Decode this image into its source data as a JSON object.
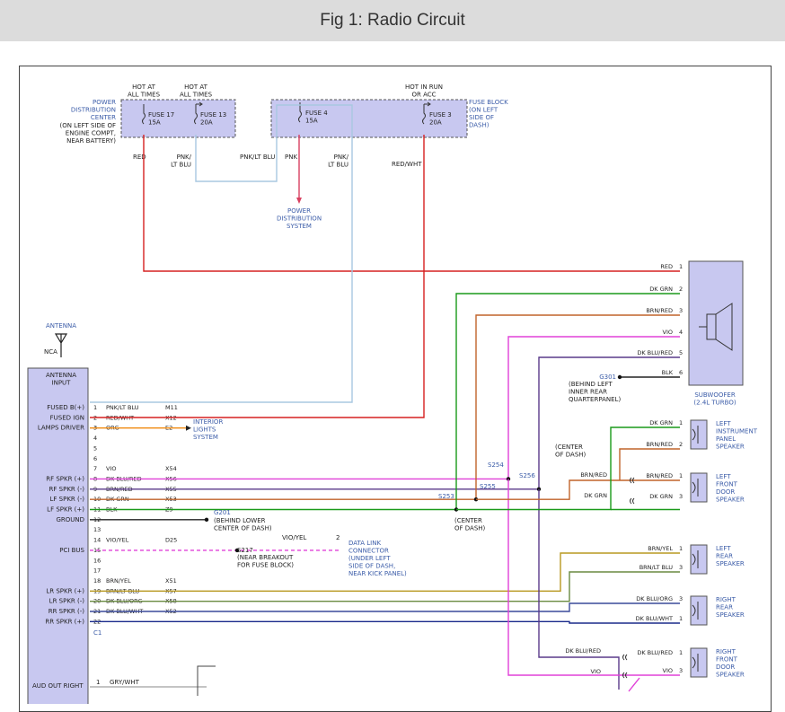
{
  "title": "Fig 1: Radio Circuit",
  "colors": {
    "red": "#d62020",
    "dkgrn": "#1a9a1a",
    "brnred": "#c0632a",
    "vio": "#e040d8",
    "dkblured": "#5a3a8a",
    "blk": "#222222",
    "org": "#f08a10",
    "ltblu": "#a8c8e0",
    "pnk": "#d84060",
    "dkbluorg": "#3a4a9a",
    "brnyel": "#b89820",
    "brnltblu": "#6a8a40",
    "dkbluwht": "#1a2a8a",
    "module_fill": "#c8c8f0",
    "label_blue": "#3b5ca8"
  },
  "power": {
    "hot_at_all_times_1": [
      "HOT AT",
      "ALL TIMES"
    ],
    "hot_at_all_times_2": [
      "HOT AT",
      "ALL TIMES"
    ],
    "hot_in_run": [
      "HOT IN RUN",
      "OR ACC"
    ],
    "pdc_label": [
      "POWER",
      "DISTRIBUTION",
      "CENTER"
    ],
    "pdc_location": [
      "(ON LEFT SIDE OF",
      "ENGINE COMPT,",
      "NEAR BATTERY)"
    ],
    "fuse17": [
      "FUSE 17",
      "15A"
    ],
    "fuse13": [
      "FUSE 13",
      "20A"
    ],
    "fuse4": [
      "FUSE 4",
      "15A"
    ],
    "fuse3": [
      "FUSE 3",
      "20A"
    ],
    "fuse_block_label": [
      "FUSE BLOCK",
      "(ON LEFT",
      "SIDE OF",
      "DASH)"
    ],
    "pdc_ref": [
      "POWER",
      "DISTRIBUTION",
      "SYSTEM"
    ]
  },
  "wire_labels": {
    "red": "RED",
    "pnk_lt_blu": [
      "PNK/",
      "LT BLU"
    ],
    "pnk_lt_blu_2": "PNK/LT BLU",
    "pnk": "PNK",
    "pnk_lt_blu_3": [
      "PNK/",
      "LT BLU"
    ],
    "red_wht": "RED/WHT"
  },
  "antenna": {
    "label": "ANTENNA",
    "nca": "NCA"
  },
  "radio": {
    "header": [
      "ANTENNA",
      "INPUT"
    ],
    "pin_labels": [
      {
        "label": "FUSED B(+)",
        "pin": "1",
        "wire": "PNK/LT BLU",
        "circuit": "M11"
      },
      {
        "label": "FUSED IGN",
        "pin": "2",
        "wire": "RED/WHT",
        "circuit": "X12"
      },
      {
        "label": "LAMPS DRIVER",
        "pin": "3",
        "wire": "ORG",
        "circuit": "E2"
      },
      {
        "label": "",
        "pin": "4",
        "wire": "",
        "circuit": ""
      },
      {
        "label": "",
        "pin": "5",
        "wire": "",
        "circuit": ""
      },
      {
        "label": "",
        "pin": "6",
        "wire": "",
        "circuit": ""
      },
      {
        "label": "",
        "pin": "7",
        "wire": "VIO",
        "circuit": "X54"
      },
      {
        "label": "RF SPKR (+)",
        "pin": "8",
        "wire": "DK BLU/RED",
        "circuit": "X56"
      },
      {
        "label": "RF SPKR (-)",
        "pin": "9",
        "wire": "BRN/RED",
        "circuit": "X55"
      },
      {
        "label": "LF SPKR (-)",
        "pin": "10",
        "wire": "DK GRN",
        "circuit": "X53"
      },
      {
        "label": "LF SPKR (+)",
        "pin": "11",
        "wire": "BLK",
        "circuit": "Z9"
      },
      {
        "label": "GROUND",
        "pin": "12",
        "wire": "",
        "circuit": ""
      },
      {
        "label": "",
        "pin": "13",
        "wire": "",
        "circuit": ""
      },
      {
        "label": "",
        "pin": "14",
        "wire": "VIO/YEL",
        "circuit": "D25"
      },
      {
        "label": "PCI BUS",
        "pin": "15",
        "wire": "",
        "circuit": ""
      },
      {
        "label": "",
        "pin": "16",
        "wire": "",
        "circuit": ""
      },
      {
        "label": "",
        "pin": "17",
        "wire": "",
        "circuit": ""
      },
      {
        "label": "",
        "pin": "18",
        "wire": "BRN/YEL",
        "circuit": "X51"
      },
      {
        "label": "LR SPKR (+)",
        "pin": "19",
        "wire": "BRN/LT BLU",
        "circuit": "X57"
      },
      {
        "label": "LR SPKR (-)",
        "pin": "20",
        "wire": "DK BLU/ORG",
        "circuit": "X58"
      },
      {
        "label": "RR SPKR (-)",
        "pin": "21",
        "wire": "DK BLU/WHT",
        "circuit": "X52"
      },
      {
        "label": "RR SPKR (+)",
        "pin": "22",
        "wire": "",
        "circuit": ""
      }
    ],
    "connector": "C1",
    "aud_out": "AUD OUT RIGHT",
    "aud_pin": "1",
    "aud_wire": "GRY/WHT"
  },
  "interior_lights": [
    "INTERIOR",
    "LIGHTS",
    "SYSTEM"
  ],
  "g201": {
    "id": "G201",
    "loc": [
      "(BEHIND LOWER",
      "CENTER OF DASH)"
    ]
  },
  "s217": {
    "id": "S217",
    "loc": [
      "(NEAR BREAKOUT",
      "FOR FUSE BLOCK)"
    ]
  },
  "dlc": {
    "wire": "VIO/YEL",
    "pin": "2",
    "label": [
      "DATA LINK",
      "CONNECTOR",
      "(UNDER LEFT",
      "SIDE OF DASH,",
      "NEAR KICK PANEL)"
    ]
  },
  "splices": {
    "s254": "S254",
    "s255": "S255",
    "s256": "S256",
    "s253": "S253",
    "center_dash_1": [
      "(CENTER",
      "OF DASH)"
    ],
    "center_dash_2": [
      "(CENTER",
      "OF DASH)"
    ]
  },
  "subwoofer": {
    "name": [
      "SUBWOOFER",
      "(2.4L TURBO)"
    ],
    "pins": [
      {
        "wire": "RED",
        "pin": "1"
      },
      {
        "wire": "DK GRN",
        "pin": "2"
      },
      {
        "wire": "BRN/RED",
        "pin": "3"
      },
      {
        "wire": "VIO",
        "pin": "4"
      },
      {
        "wire": "DK BLU/RED",
        "pin": "5"
      },
      {
        "wire": "BLK",
        "pin": "6"
      }
    ],
    "g301": "G301",
    "g301_loc": [
      "(BEHIND LEFT",
      "INNER REAR",
      "QUARTERPANEL)"
    ]
  },
  "speakers": {
    "left_ip": {
      "name": [
        "LEFT",
        "INSTRUMENT",
        "PANEL",
        "SPEAKER"
      ],
      "w1": "DK GRN",
      "p1": "1",
      "w2": "BRN/RED",
      "p2": "2"
    },
    "left_front": {
      "name": [
        "LEFT",
        "FRONT",
        "DOOR",
        "SPEAKER"
      ],
      "w1": "BRN/RED",
      "p1": "1",
      "w2": "DK GRN",
      "p2": "3",
      "in1": "BRN/RED",
      "in2": "DK GRN"
    },
    "left_rear": {
      "name": [
        "LEFT",
        "REAR",
        "SPEAKER"
      ],
      "w1": "BRN/YEL",
      "p1": "1",
      "w2": "BRN/LT BLU",
      "p2": "3"
    },
    "right_rear": {
      "name": [
        "RIGHT",
        "REAR",
        "SPEAKER"
      ],
      "w1": "DK BLU/ORG",
      "p1": "3",
      "w2": "DK BLU/WHT",
      "p2": "1"
    },
    "right_front": {
      "name": [
        "RIGHT",
        "FRONT",
        "DOOR",
        "SPEAKER"
      ],
      "w1": "DK BLU/RED",
      "p1": "1",
      "w2": "VIO",
      "p2": "3",
      "in1": "DK BLU/RED",
      "in2": "VIO"
    }
  }
}
